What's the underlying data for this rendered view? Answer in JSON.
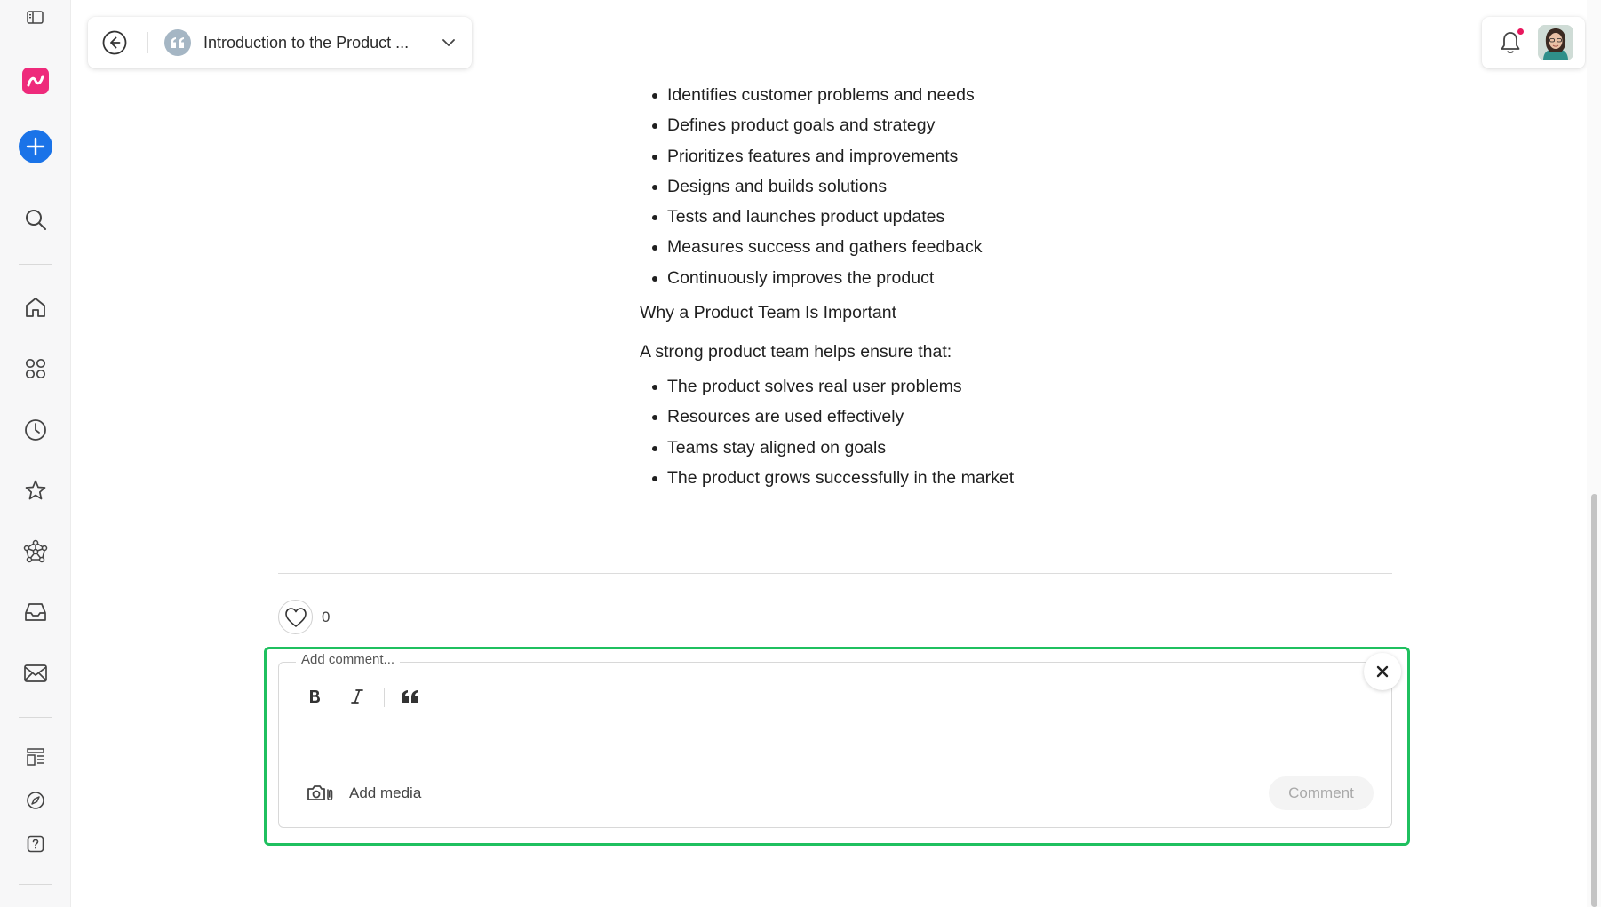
{
  "header": {
    "doc_title": "Introduction to the Product ..."
  },
  "content": {
    "bullets_top": [
      "Identifies customer problems and needs",
      "Defines product goals and strategy",
      "Prioritizes features and improvements",
      "Designs and builds solutions",
      "Tests and launches product updates",
      "Measures success and gathers feedback",
      "Continuously improves the product"
    ],
    "heading": "Why a Product Team Is Important",
    "intro": "A strong product team helps ensure that:",
    "bullets_bottom": [
      "The product solves real user problems",
      "Resources are used effectively",
      "Teams stay aligned on goals",
      "The product grows successfully in the market"
    ]
  },
  "reactions": {
    "like_count": "0"
  },
  "comment": {
    "legend": "Add comment...",
    "add_media_label": "Add media",
    "submit_label": "Comment"
  },
  "colors": {
    "accent_blue": "#1a73e8",
    "brand_pink": "#ee2a7b",
    "focus_green": "#1fc05f",
    "notification_dot": "#e8175d"
  },
  "icons": {
    "sidebar": [
      "sidebar-toggle-icon",
      "brand-logo-icon",
      "plus-icon",
      "search-icon",
      "home-icon",
      "apps-icon",
      "clock-icon",
      "star-icon",
      "network-icon",
      "inbox-icon",
      "mail-icon",
      "templates-icon",
      "compass-icon",
      "help-icon"
    ]
  }
}
